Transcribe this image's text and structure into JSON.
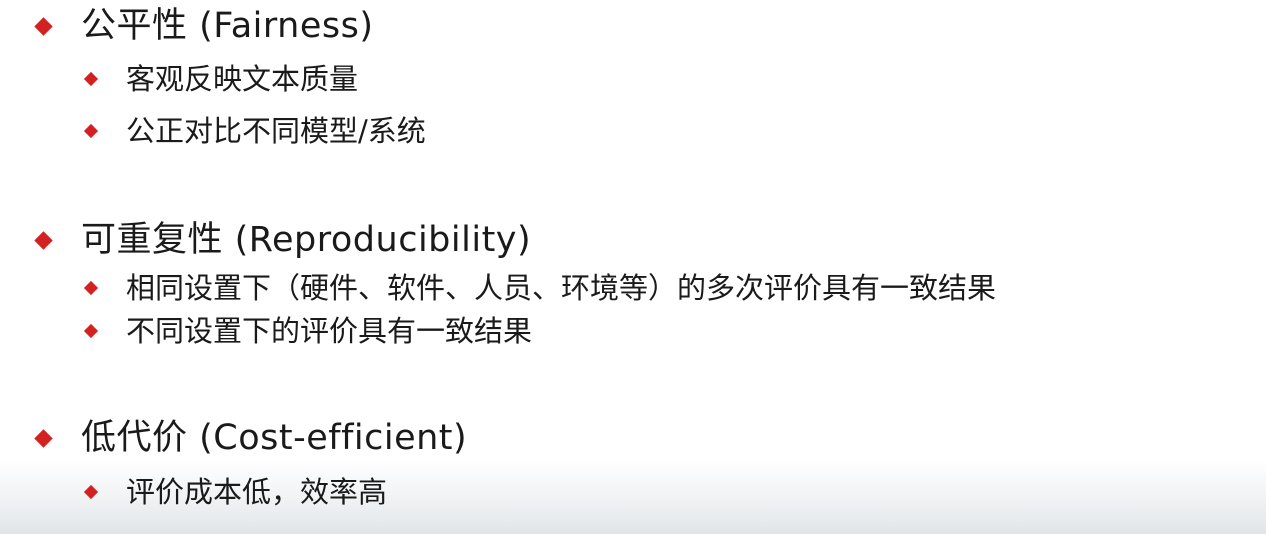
{
  "sections": [
    {
      "heading": "公平性 (Fairness)",
      "items": [
        "客观反映文本质量",
        "公正对比不同模型/系统"
      ]
    },
    {
      "heading": "可重复性 (Reproducibility)",
      "items": [
        "相同设置下（硬件、软件、人员、环境等）的多次评价具有一致结果",
        "不同设置下的评价具有一致结果"
      ]
    },
    {
      "heading": "低代价 (Cost-efficient)",
      "items": [
        "评价成本低，效率高"
      ]
    }
  ],
  "colors": {
    "bullet": "#d32020",
    "text": "#1a1a1a",
    "background": "#ffffff"
  }
}
